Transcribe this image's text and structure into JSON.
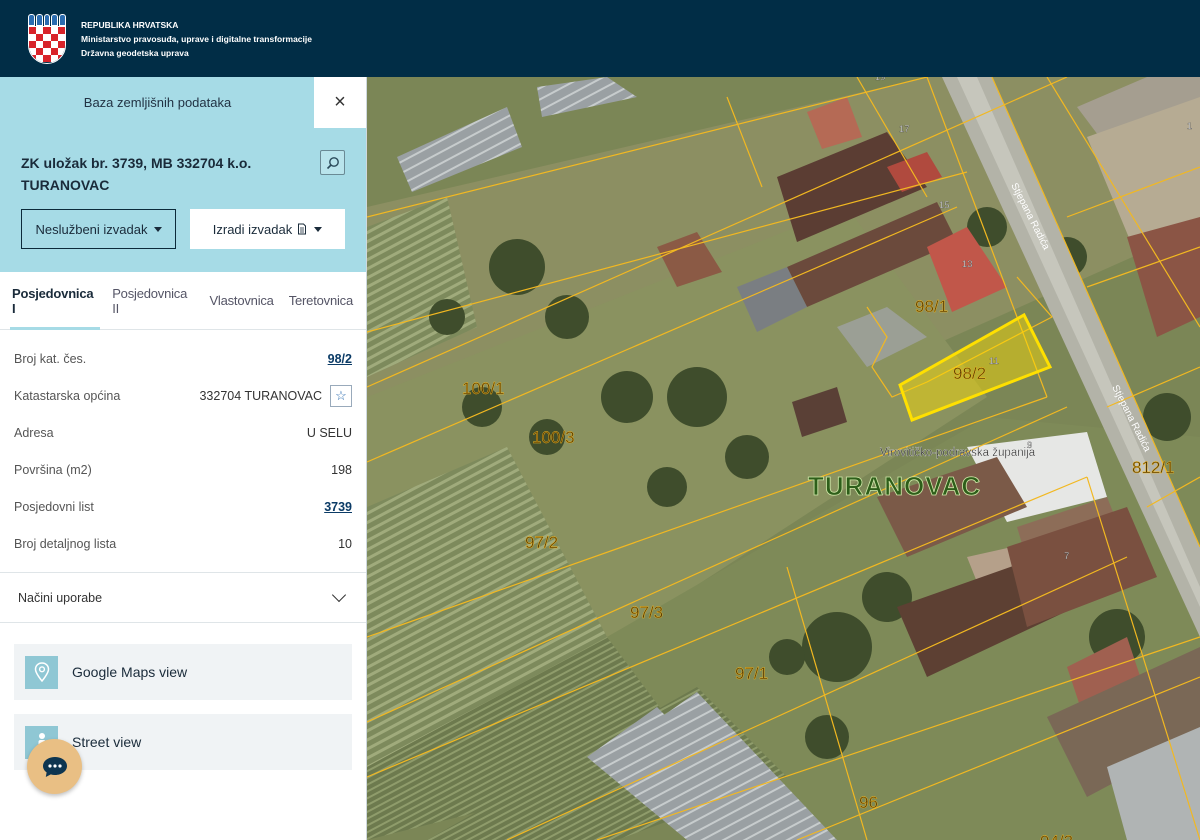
{
  "header": {
    "line1": "REPUBLIKA HRVATSKA",
    "line2": "Ministarstvo pravosuđa, uprave i digitalne transformacije",
    "line3": "Državna geodetska uprava"
  },
  "sidebar": {
    "db_tab": "Baza zemljišnih podataka",
    "close_icon": "×",
    "title_line1": "ZK uložak br. 3739, MB 332704 k.o.",
    "title_line2": "TURANOVAC",
    "btn_unofficial": "Neslužbeni izvadak",
    "btn_create": "Izradi izvadak",
    "tabs": [
      "Posjedovnica I",
      "Posjedovnica II",
      "Vlastovnica",
      "Teretovnica"
    ],
    "properties": [
      {
        "label": "Broj kat. čes.",
        "value": "98/2"
      },
      {
        "label": "Katastarska općina",
        "value": "332704 TURANOVAC"
      },
      {
        "label": "Adresa",
        "value": "U SELU"
      },
      {
        "label": "Površina (m2)",
        "value": "198"
      },
      {
        "label": "Posjedovni list",
        "value": "3739"
      },
      {
        "label": "Broj detaljnog lista",
        "value": "10"
      }
    ],
    "accordion_label": "Načini uporabe",
    "google_maps": "Google Maps view",
    "street_view": "Street view"
  },
  "map": {
    "parcels": [
      "100/1",
      "100/3",
      "97/2",
      "97/3",
      "97/1",
      "96",
      "98/1",
      "98/2",
      "812/1",
      "94/3"
    ],
    "house_numbers": [
      "17",
      "15",
      "13",
      "11",
      "9",
      "7",
      "19",
      "1"
    ],
    "street_name": "Stjepana Radića",
    "region_label": "Virovitičko-podravska županija",
    "town_label": "TURANOVAC"
  },
  "colors": {
    "header_bg": "#012d46",
    "panel_bg": "#a6dbe6",
    "parcel_line": "#f2b821",
    "highlight": "#ffe000"
  }
}
